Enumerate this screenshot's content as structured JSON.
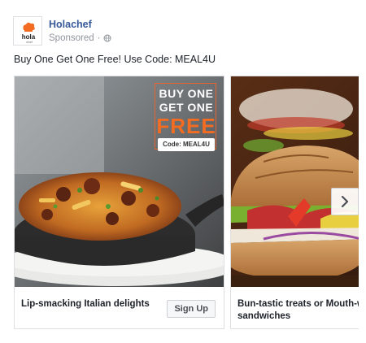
{
  "post": {
    "page_name": "Holachef",
    "sponsored_label": "Sponsored",
    "separator": "·",
    "text": "Buy One Get One Free! Use Code: MEAL4U"
  },
  "avatar": {
    "brand_text": "hola",
    "brand_sub": "chef"
  },
  "carousel": {
    "cards": [
      {
        "caption": "Lip-smacking Italian delights",
        "cta_label": "Sign Up",
        "promo": {
          "line1": "BUY ONE",
          "line2": "GET ONE",
          "big": "FREE",
          "code": "Code: MEAL4U"
        }
      },
      {
        "caption": "Bun-tastic treats or Mouth-watering sandwiches"
      }
    ]
  },
  "colors": {
    "brand_link": "#365899",
    "promo_orange": "#f36c21",
    "meta_gray": "#90949c"
  },
  "icons": {
    "globe": "globe-icon",
    "next": "chevron-right-icon"
  }
}
